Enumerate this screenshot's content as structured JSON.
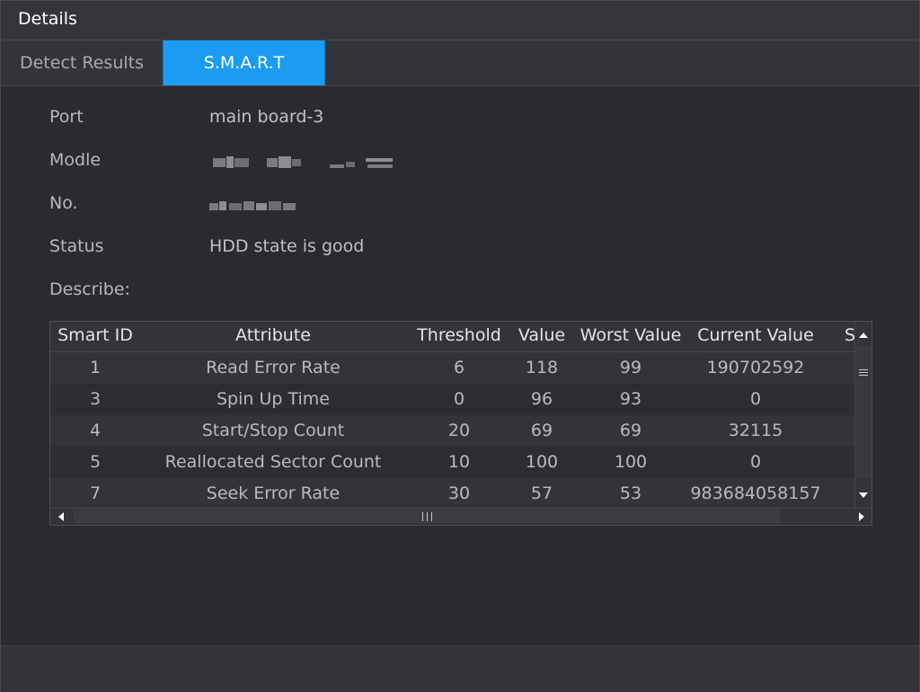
{
  "window": {
    "title": "Details"
  },
  "tabs": [
    {
      "label": "Detect Results",
      "active": false
    },
    {
      "label": "S.M.A.R.T",
      "active": true
    }
  ],
  "fields": {
    "port": {
      "label": "Port",
      "value": "main board-3"
    },
    "model": {
      "label": "Modle"
    },
    "serial": {
      "label": "No."
    },
    "status": {
      "label": "Status",
      "value": "HDD state is good"
    },
    "describe": {
      "label": "Describe:"
    }
  },
  "table": {
    "columns": [
      "Smart ID",
      "Attribute",
      "Threshold",
      "Value",
      "Worst Value",
      "Current Value",
      "S"
    ],
    "rows": [
      {
        "id": "1",
        "attribute": "Read Error Rate",
        "threshold": "6",
        "value": "118",
        "worst": "99",
        "current": "190702592"
      },
      {
        "id": "3",
        "attribute": "Spin Up Time",
        "threshold": "0",
        "value": "96",
        "worst": "93",
        "current": "0"
      },
      {
        "id": "4",
        "attribute": "Start/Stop Count",
        "threshold": "20",
        "value": "69",
        "worst": "69",
        "current": "32115"
      },
      {
        "id": "5",
        "attribute": "Reallocated Sector Count",
        "threshold": "10",
        "value": "100",
        "worst": "100",
        "current": "0"
      },
      {
        "id": "7",
        "attribute": "Seek Error Rate",
        "threshold": "30",
        "value": "57",
        "worst": "53",
        "current": "983684058157"
      }
    ]
  },
  "colors": {
    "accent": "#1a9cf0",
    "background": "#2a2b30",
    "header": "#34353a"
  },
  "icons": {
    "scroll_up": "triangle-up-icon",
    "scroll_down": "triangle-down-icon",
    "scroll_left": "triangle-left-icon",
    "scroll_right": "triangle-right-icon"
  }
}
